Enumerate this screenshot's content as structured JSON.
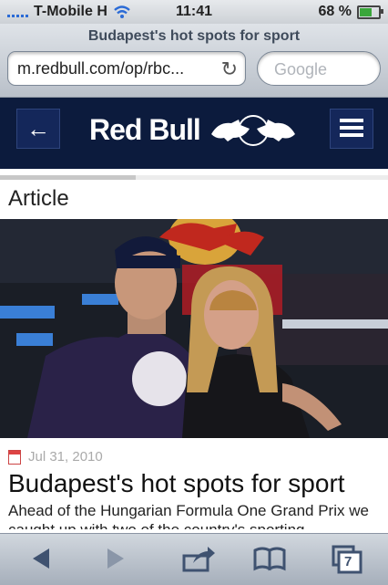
{
  "status": {
    "carrier": "T-Mobile H",
    "time": "11:41",
    "battery": "68 %",
    "battery_level": 0.68
  },
  "browser": {
    "page_title": "Budapest's hot spots for sport",
    "url": "m.redbull.com/op/rbc...",
    "search_placeholder": "Google",
    "tabs_count": "7"
  },
  "site": {
    "brand": "Red Bull"
  },
  "article": {
    "section": "Article",
    "progress": 0.35,
    "date": "Jul 31, 2010",
    "title": "Budapest's hot spots for sport",
    "lead": "Ahead of the Hungarian Formula One Grand Prix we caught up with two of the country's sporting"
  }
}
